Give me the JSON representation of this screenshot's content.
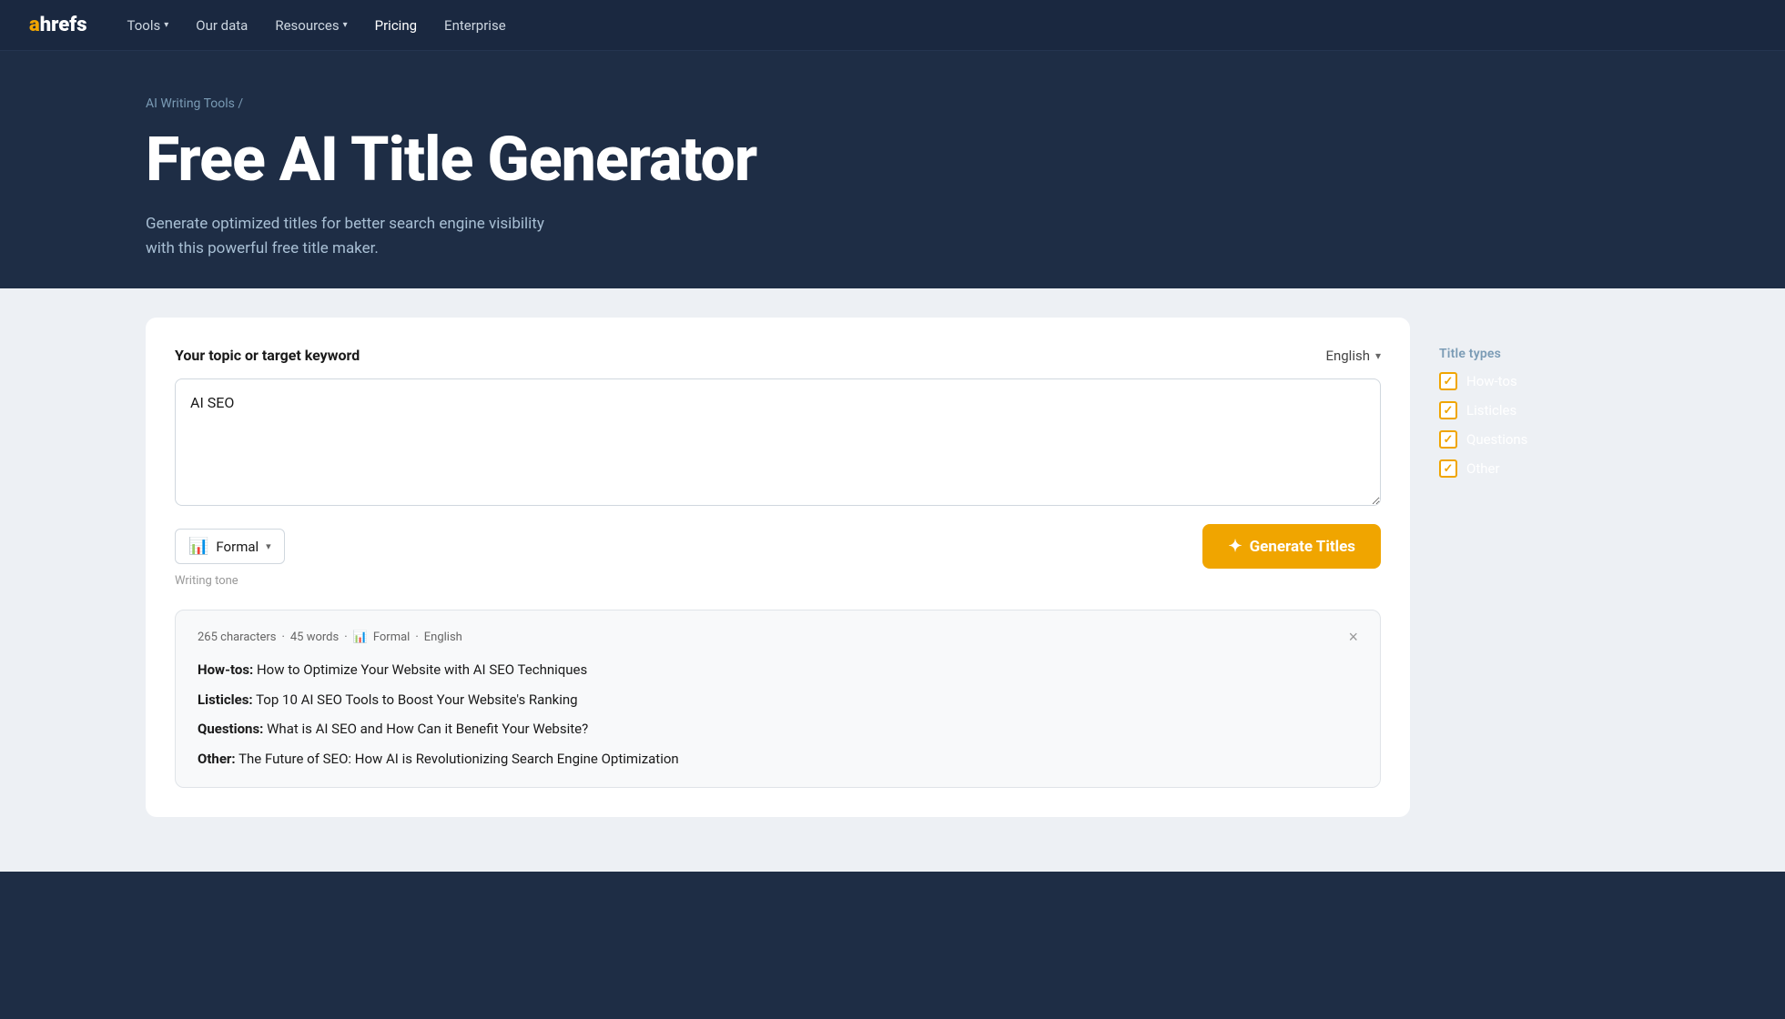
{
  "nav": {
    "logo_a": "a",
    "logo_rest": "hrefs",
    "links": [
      {
        "label": "Tools",
        "has_dropdown": true
      },
      {
        "label": "Our data",
        "has_dropdown": false
      },
      {
        "label": "Resources",
        "has_dropdown": true
      },
      {
        "label": "Pricing",
        "has_dropdown": false
      },
      {
        "label": "Enterprise",
        "has_dropdown": false
      }
    ]
  },
  "hero": {
    "breadcrumb_link": "AI Writing Tools",
    "breadcrumb_sep": "/",
    "title": "Free AI Title Generator",
    "description": "Generate optimized titles for better search engine visibility with this powerful free title maker."
  },
  "tool": {
    "keyword_label": "Your topic or target keyword",
    "language": "English",
    "language_chevron": "▾",
    "textarea_value": "AI SEO",
    "tone_label": "Formal",
    "tone_icon": "📊",
    "writing_tone_hint": "Writing tone",
    "generate_button_label": "Generate Titles",
    "spark": "✦"
  },
  "results": {
    "meta_chars": "265 characters",
    "meta_dot1": "·",
    "meta_words": "45 words",
    "meta_dot2": "·",
    "meta_tone_icon": "📊",
    "meta_tone": "Formal",
    "meta_dot3": "·",
    "meta_lang": "English",
    "items": [
      {
        "type": "How-tos",
        "sep": ":",
        "text": " How to Optimize Your Website with AI SEO Techniques"
      },
      {
        "type": "Listicles",
        "sep": ":",
        "text": " Top 10 AI SEO Tools to Boost Your Website's Ranking"
      },
      {
        "type": "Questions",
        "sep": ":",
        "text": " What is AI SEO and How Can it Benefit Your Website?"
      },
      {
        "type": "Other",
        "sep": ":",
        "text": " The Future of SEO: How AI is Revolutionizing Search Engine Optimization"
      }
    ]
  },
  "sidebar": {
    "title_types_label": "Title types",
    "checkboxes": [
      {
        "label": "How-tos",
        "checked": true
      },
      {
        "label": "Listicles",
        "checked": true
      },
      {
        "label": "Questions",
        "checked": true
      },
      {
        "label": "Other",
        "checked": true
      }
    ]
  }
}
